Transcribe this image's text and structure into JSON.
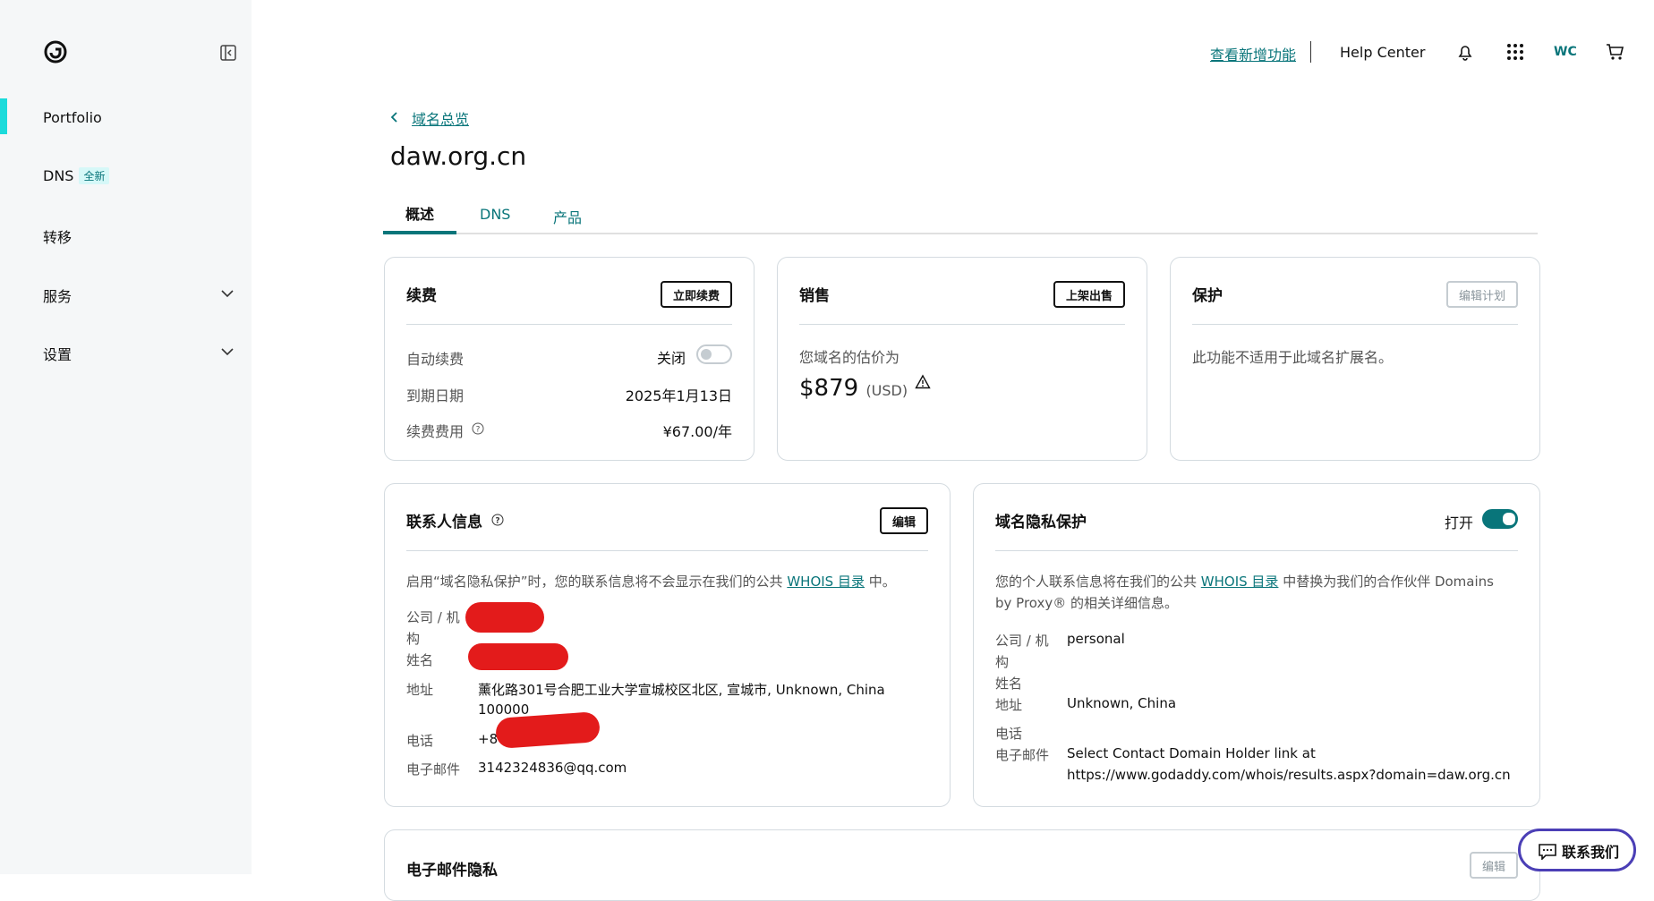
{
  "sidebar": {
    "items": [
      {
        "label": "Portfolio"
      },
      {
        "label": "DNS",
        "badge": "全新"
      },
      {
        "label": "转移"
      },
      {
        "label": "服务"
      },
      {
        "label": "设置"
      }
    ]
  },
  "topbar": {
    "whats_new": "查看新增功能",
    "help": "Help Center",
    "user_initials": "WC"
  },
  "breadcrumb": "域名总览",
  "domain": "daw.org.cn",
  "tabs": [
    "概述",
    "DNS",
    "产品"
  ],
  "renewal": {
    "title": "续费",
    "button": "立即续费",
    "auto_renew_label": "自动续费",
    "auto_renew_status": "关闭",
    "auto_renew_on": false,
    "expiry_label": "到期日期",
    "expiry_value": "2025年1月13日",
    "fee_label": "续费费用",
    "fee_value": "¥67.00/年"
  },
  "sales": {
    "title": "销售",
    "button": "上架出售",
    "estimate_label": "您域名的估价为",
    "price": "$879",
    "currency": "(USD)"
  },
  "protection": {
    "title": "保护",
    "button": "编辑计划",
    "message": "此功能不适用于此域名扩展名。"
  },
  "contact": {
    "title": "联系人信息",
    "button": "编辑",
    "note_before": "启用“域名隐私保护”时，您的联系信息将不会显示在我们的公共 ",
    "note_link": "WHOIS 目录",
    "note_after": " 中。",
    "company_label_1": "公司 / 机",
    "company_label_2": "构",
    "name_label": "姓名",
    "address_label": "地址",
    "address_line1": "薰化路301号合肥工业大学宣城校区北区, 宣城市, Unknown, China",
    "address_line2": "100000",
    "phone_label": "电话",
    "phone_value": "+8",
    "email_label": "电子邮件",
    "email_value": "3142324836@qq.com"
  },
  "privacy": {
    "title": "域名隐私保护",
    "status": "打开",
    "enabled": true,
    "note_before": "您的个人联系信息将在我们的公共 ",
    "note_link": "WHOIS 目录",
    "note_after": " 中替换为我们的合作伙伴 Domains",
    "note_line2": "by Proxy® 的相关详细信息。",
    "company_label_1": "公司 / 机",
    "company_label_2": "构",
    "company_value": "personal",
    "name_label": "姓名",
    "address_label": "地址",
    "address_value": "Unknown, China",
    "phone_label": "电话",
    "email_label": "电子邮件",
    "email_line1": "Select Contact Domain Holder link at",
    "email_line2": "https://www.godaddy.com/whois/results.aspx?domain=daw.org.cn"
  },
  "email_privacy": {
    "title": "电子邮件隐私",
    "button": "编辑"
  },
  "chat": {
    "label": "联系我们"
  },
  "colors": {
    "accent": "#09757a",
    "active_bar": "#1bdbdb",
    "chat_border": "#4b3fb6"
  }
}
